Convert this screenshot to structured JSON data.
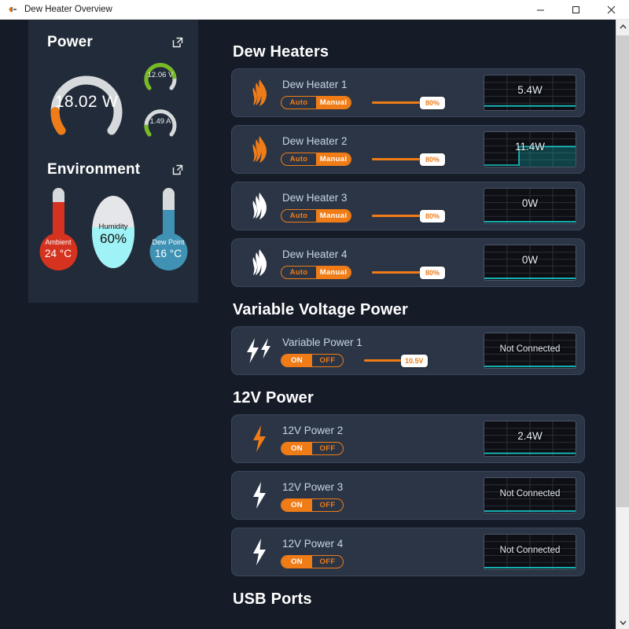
{
  "window": {
    "title": "Dew Heater Overview",
    "icon": "app-icon",
    "minimize_label": "Minimize",
    "maximize_label": "Maximize",
    "close_label": "Close"
  },
  "sidebar": {
    "power": {
      "title": "Power",
      "expand_icon": "external-link-icon",
      "main_gauge": {
        "value": "18.02 W",
        "percent": 12,
        "color": "#f07c17",
        "track": "#d7dadd"
      },
      "small_gauges": [
        {
          "name": "voltage",
          "value": "12.06 V",
          "percent": 76,
          "color": "#76bc21",
          "track": "#d7dadd"
        },
        {
          "name": "current",
          "value": "1.49 A",
          "percent": 13,
          "color": "#76bc21",
          "track": "#d7dadd"
        }
      ]
    },
    "environment": {
      "title": "Environment",
      "expand_icon": "external-link-icon",
      "items": [
        {
          "name": "ambient",
          "label": "Ambient",
          "value": "24 °C",
          "fill_percent": 72,
          "color": "#d5331f"
        },
        {
          "name": "humidity",
          "label": "Humidity",
          "value": "60%",
          "fill_percent": 60,
          "color": "#9ff2f5"
        },
        {
          "name": "dew-point",
          "label": "Dew Point",
          "value": "16 °C",
          "fill_percent": 58,
          "color": "#3f92b4"
        }
      ]
    }
  },
  "main": {
    "sections": [
      {
        "id": "dew-heaters",
        "title": "Dew Heaters",
        "cards": [
          {
            "name": "Dew Heater 1",
            "icon": "flame-icon",
            "icon_active": true,
            "toggle": {
              "type": "auto-manual",
              "options": [
                "Auto",
                "Manual"
              ],
              "active": "Manual"
            },
            "slider": {
              "value": "80%",
              "percent": 80
            },
            "chart": {
              "label": "5.4W",
              "type": "flat",
              "level": 0.12
            }
          },
          {
            "name": "Dew Heater 2",
            "icon": "flame-icon",
            "icon_active": true,
            "toggle": {
              "type": "auto-manual",
              "options": [
                "Auto",
                "Manual"
              ],
              "active": "Manual"
            },
            "slider": {
              "value": "80%",
              "percent": 80
            },
            "chart": {
              "label": "11.4W",
              "type": "step",
              "level": 0.58
            }
          },
          {
            "name": "Dew Heater 3",
            "icon": "flame-icon",
            "icon_active": false,
            "toggle": {
              "type": "auto-manual",
              "options": [
                "Auto",
                "Manual"
              ],
              "active": "Manual"
            },
            "slider": {
              "value": "80%",
              "percent": 80
            },
            "chart": {
              "label": "0W",
              "type": "flat",
              "level": 0.03
            }
          },
          {
            "name": "Dew Heater 4",
            "icon": "flame-icon",
            "icon_active": false,
            "toggle": {
              "type": "auto-manual",
              "options": [
                "Auto",
                "Manual"
              ],
              "active": "Manual"
            },
            "slider": {
              "value": "80%",
              "percent": 80
            },
            "chart": {
              "label": "0W",
              "type": "flat",
              "level": 0.03
            }
          }
        ]
      },
      {
        "id": "variable-voltage-power",
        "title": "Variable Voltage Power",
        "cards": [
          {
            "name": "Variable Power 1",
            "icon": "double-bolt-icon",
            "icon_active": false,
            "toggle": {
              "type": "on-off",
              "options": [
                "ON",
                "OFF"
              ],
              "active": "ON"
            },
            "slider": {
              "value": "10.5V",
              "percent": 62
            },
            "chart": {
              "label": "Not Connected",
              "type": "flat",
              "level": 0.02
            }
          }
        ]
      },
      {
        "id": "12v-power",
        "title": "12V Power",
        "cards": [
          {
            "name": "12V Power 2",
            "icon": "bolt-icon",
            "icon_active": true,
            "toggle": {
              "type": "on-off",
              "options": [
                "ON",
                "OFF"
              ],
              "active": "ON"
            },
            "slider": null,
            "chart": {
              "label": "2.4W",
              "type": "flat",
              "level": 0.08
            }
          },
          {
            "name": "12V Power 3",
            "icon": "bolt-icon",
            "icon_active": false,
            "toggle": {
              "type": "on-off",
              "options": [
                "ON",
                "OFF"
              ],
              "active": "ON"
            },
            "slider": null,
            "chart": {
              "label": "Not Connected",
              "type": "flat",
              "level": 0.02
            }
          },
          {
            "name": "12V Power 4",
            "icon": "bolt-icon",
            "icon_active": false,
            "toggle": {
              "type": "on-off",
              "options": [
                "ON",
                "OFF"
              ],
              "active": "ON"
            },
            "slider": null,
            "chart": {
              "label": "Not Connected",
              "type": "flat",
              "level": 0.02
            }
          }
        ]
      },
      {
        "id": "usb-ports",
        "title": "USB Ports",
        "cards": []
      }
    ]
  },
  "scrollbar": {
    "up_icon": "chevron-up-icon",
    "down_icon": "chevron-down-icon"
  },
  "colors": {
    "accent": "#f07c17",
    "green": "#76bc21",
    "teal": "#17c8c8",
    "card_bg": "#2b3545",
    "panel_bg": "#222b39",
    "app_bg": "#151c28"
  }
}
